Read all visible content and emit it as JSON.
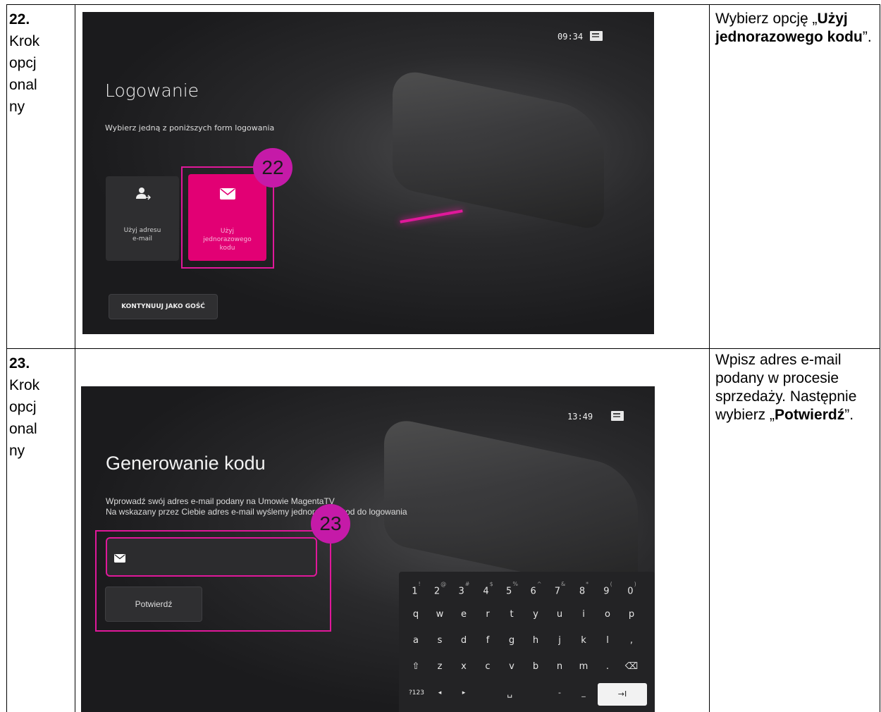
{
  "rows": [
    {
      "step_number": "22.",
      "step_label_lines": [
        "Krok",
        "opcj",
        "onal",
        "ny"
      ],
      "description": {
        "prefix": "Wybierz opcję „",
        "bold": "Użyj jednorazowego kodu",
        "suffix": "”."
      },
      "screen": {
        "clock": "09:34",
        "title": "Logowanie",
        "subtitle": "Wybierz jedną z poniższych form logowania",
        "tiles": [
          {
            "label_lines": [
              "Użyj adresu",
              "e-mail"
            ],
            "icon": "user-arrow-icon"
          },
          {
            "label_lines": [
              "Użyj",
              "jednorazowego",
              "kodu"
            ],
            "icon": "envelope-icon"
          }
        ],
        "guest_button": "KONTYNUUJ JAKO GOŚĆ",
        "badge": "22",
        "accent": "#e20074"
      }
    },
    {
      "step_number": "23.",
      "step_label_lines": [
        "Krok",
        "opcj",
        "onal",
        "ny"
      ],
      "description": {
        "prefix": "Wpisz adres e-mail podany w procesie sprzedaży. Następnie wybierz „",
        "bold": "Potwierdź",
        "suffix": "”."
      },
      "screen": {
        "clock": "13:49",
        "title": "Generowanie kodu",
        "subtitle_line1": "Wprowadź swój adres e-mail podany na Umowie MagentaTV",
        "subtitle_line2": "Na wskazany przez Ciebie adres e-mail wyślemy jednorazowy kod do logowania",
        "email_icon": "envelope-icon",
        "confirm_button": "Potwierdź",
        "badge": "23",
        "keyboard": {
          "row1": [
            [
              "1",
              "!"
            ],
            [
              "2",
              "@"
            ],
            [
              "3",
              "#"
            ],
            [
              "4",
              "$"
            ],
            [
              "5",
              "%"
            ],
            [
              "6",
              "^"
            ],
            [
              "7",
              "&"
            ],
            [
              "8",
              "*"
            ],
            [
              "9",
              "("
            ],
            [
              "0",
              ")"
            ]
          ],
          "row2": [
            "q",
            "w",
            "e",
            "r",
            "t",
            "y",
            "u",
            "i",
            "o",
            "p"
          ],
          "row3": [
            "a",
            "s",
            "d",
            "f",
            "g",
            "h",
            "j",
            "k",
            "l",
            ","
          ],
          "row4": [
            "⇧",
            "z",
            "x",
            "c",
            "v",
            "b",
            "n",
            "m",
            ".",
            "⌫"
          ],
          "row5": [
            "?123",
            "◂",
            "▸",
            "␣",
            "-",
            "_",
            "→I"
          ]
        }
      }
    }
  ]
}
